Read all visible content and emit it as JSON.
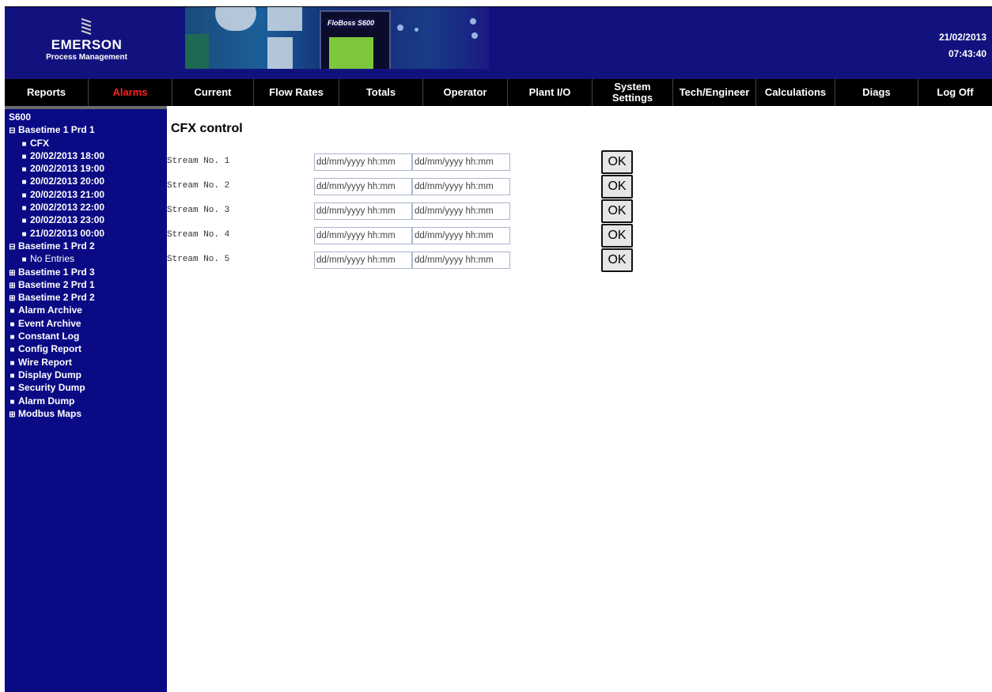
{
  "header": {
    "logo": {
      "brand": "EMERSON",
      "sub": "Process Management"
    },
    "banner": {
      "device_label": "FloBoss S600"
    },
    "date": "21/02/2013",
    "time": "07:43:40"
  },
  "nav": {
    "items": [
      {
        "label": "Reports",
        "active": false
      },
      {
        "label": "Alarms",
        "active": true
      },
      {
        "label": "Current",
        "active": false
      },
      {
        "label": "Flow Rates",
        "active": false
      },
      {
        "label": "Totals",
        "active": false
      },
      {
        "label": "Operator",
        "active": false
      },
      {
        "label": "Plant I/O",
        "active": false
      },
      {
        "label": "System Settings",
        "active": false
      },
      {
        "label": "Tech/Engineer",
        "active": false
      },
      {
        "label": "Calculations",
        "active": false
      },
      {
        "label": "Diags",
        "active": false
      },
      {
        "label": "Log Off",
        "active": false
      }
    ],
    "active_color": "#ff2020"
  },
  "sidebar": {
    "root": "S600",
    "items": [
      {
        "label": "Basetime 1 Prd 1",
        "icon": "minus-box-icon"
      },
      {
        "label": "CFX",
        "icon": "square-bullet-icon"
      },
      {
        "label": "20/02/2013 18:00",
        "icon": "square-bullet-icon"
      },
      {
        "label": "20/02/2013 19:00",
        "icon": "square-bullet-icon"
      },
      {
        "label": "20/02/2013 20:00",
        "icon": "square-bullet-icon"
      },
      {
        "label": "20/02/2013 21:00",
        "icon": "square-bullet-icon"
      },
      {
        "label": "20/02/2013 22:00",
        "icon": "square-bullet-icon"
      },
      {
        "label": "20/02/2013 23:00",
        "icon": "square-bullet-icon"
      },
      {
        "label": "21/02/2013 00:00",
        "icon": "square-bullet-icon"
      },
      {
        "label": "Basetime 1 Prd 2",
        "icon": "minus-box-icon"
      },
      {
        "label": "No Entries",
        "icon": "square-bullet-icon"
      },
      {
        "label": "Basetime 1 Prd 3",
        "icon": "plus-box-icon"
      },
      {
        "label": "Basetime 2 Prd 1",
        "icon": "plus-box-icon"
      },
      {
        "label": "Basetime 2 Prd 2",
        "icon": "plus-box-icon"
      },
      {
        "label": "Alarm Archive",
        "icon": "square-bullet-icon"
      },
      {
        "label": "Event Archive",
        "icon": "square-bullet-icon"
      },
      {
        "label": "Constant Log",
        "icon": "square-bullet-icon"
      },
      {
        "label": "Config Report",
        "icon": "square-bullet-icon"
      },
      {
        "label": "Wire Report",
        "icon": "square-bullet-icon"
      },
      {
        "label": "Display Dump",
        "icon": "square-bullet-icon"
      },
      {
        "label": "Security Dump",
        "icon": "square-bullet-icon"
      },
      {
        "label": "Alarm Dump",
        "icon": "square-bullet-icon"
      },
      {
        "label": "Modbus Maps",
        "icon": "plus-box-icon"
      }
    ]
  },
  "main": {
    "title": "CFX control",
    "streams": [
      {
        "label": "Stream No. 1",
        "from_placeholder": "dd/mm/yyyy hh:mm",
        "to_placeholder": "dd/mm/yyyy hh:mm",
        "ok_label": "OK"
      },
      {
        "label": "Stream No. 2",
        "from_placeholder": "dd/mm/yyyy hh:mm",
        "to_placeholder": "dd/mm/yyyy hh:mm",
        "ok_label": "OK"
      },
      {
        "label": "Stream No. 3",
        "from_placeholder": "dd/mm/yyyy hh:mm",
        "to_placeholder": "dd/mm/yyyy hh:mm",
        "ok_label": "OK"
      },
      {
        "label": "Stream No. 4",
        "from_placeholder": "dd/mm/yyyy hh:mm",
        "to_placeholder": "dd/mm/yyyy hh:mm",
        "ok_label": "OK"
      },
      {
        "label": "Stream No. 5",
        "from_placeholder": "dd/mm/yyyy hh:mm",
        "to_placeholder": "dd/mm/yyyy hh:mm",
        "ok_label": "OK"
      }
    ]
  },
  "colors": {
    "header_bg": "#12127e",
    "sidebar_bg": "#0a0a84",
    "nav_bg": "#000000"
  }
}
